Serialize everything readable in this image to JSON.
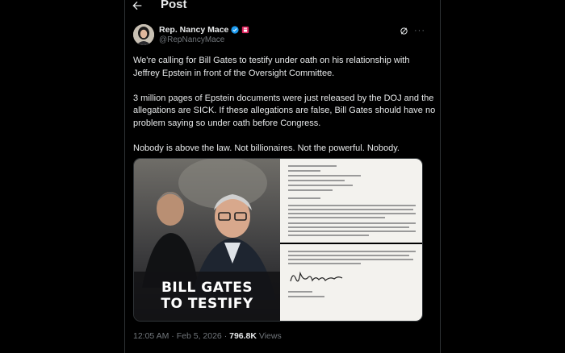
{
  "header": {
    "title": "Post"
  },
  "tweet": {
    "author": {
      "display_name": "Rep. Nancy Mace",
      "handle": "@RepNancyMace"
    },
    "paragraphs": [
      "We're calling for Bill Gates to testify under oath on his relationship with Jeffrey Epstein in front of the Oversight Committee.",
      "3 million pages of Epstein documents were just released by the DOJ and the allegations are SICK. If these allegations are false, Bill Gates should have no problem saying so under oath before Congress.",
      "Nobody is above the law. Not billionaires. Not the powerful. Nobody."
    ],
    "media": {
      "headline_line1": "BILL GATES",
      "headline_line2": "TO TESTIFY"
    },
    "meta": {
      "time": "12:05 AM",
      "separator": "·",
      "date": "Feb 5, 2026",
      "views_count": "796.8K",
      "views_label": "Views"
    }
  },
  "colors": {
    "background": "#000000",
    "text_primary": "#e7e9ea",
    "text_secondary": "#71767b",
    "verified_blue": "#1d9bf0",
    "flag_red": "#e0245e"
  }
}
